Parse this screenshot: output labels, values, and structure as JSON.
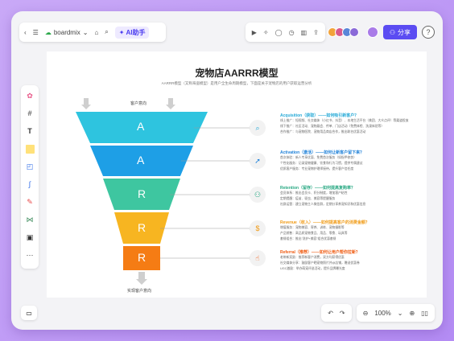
{
  "app": {
    "brand": "boardmix",
    "ai_label": "AI助手",
    "share_label": "分享",
    "help_label": "?",
    "zoom": "100%"
  },
  "diagram": {
    "title": "宠物店AARRR模型",
    "subtitle": "AARRR模型（又称海盗模型）是用户全生命周期模型，下面是关于宠物店的用户获取运营分析",
    "top_label": "客户意向",
    "bottom_label": "实现客户意向",
    "stages": [
      {
        "letter": "A",
        "color": "#2ec4df",
        "heading": "Acquisition（获取）——如何吸引新客户？",
        "head_color": "#22a8d6",
        "lines": [
          "线上推广：短视频、社交媒体（小红书、抖音）、本地生活平台（美团、大众点评）等渠道投放",
          "线下推广：社区活动、宠物展会、传单、门店活动（免费体检、洗澡体验等）",
          "合作推广：与宠物医院、宠物用品商店合作，推出联名优惠活动"
        ]
      },
      {
        "letter": "A",
        "color": "#1e9fe6",
        "heading": "Activation（激活）——如何让新客户留下来？",
        "head_color": "#1b7fd8",
        "lines": [
          "首次体验：新人专享优惠、免费首次服务（如指甲修剪）",
          "个性化服务：记录宠物健康、饮食和行为习惯，提供专属建议",
          "优质客户服务：专业宠物护理师接待，提升客户信任度"
        ]
      },
      {
        "letter": "R",
        "color": "#3ec6a0",
        "heading": "Retention（留存）——如何提高复购率？",
        "head_color": "#27a882",
        "lines": [
          "会员体系：推出会员卡、积分制度，增加客户粘性",
          "定期提醒：疫苗、驱虫、美容等提醒服务",
          "社群运营：建立宠物主人微信群，定期分享养宠知识和优惠信息"
        ]
      },
      {
        "letter": "R",
        "color": "#f7b521",
        "heading": "Revenue（收入）——如何提高客户的消费金额？",
        "head_color": "#f09a14",
        "lines": [
          "增值服务：宠物美容、寄养、训练、宠物摄影等",
          "产品销售：高品质宠物食品、用品、零食、玩具等",
          "套餐组合：推出\"洗护+美容\"组合优惠套餐"
        ]
      },
      {
        "letter": "R",
        "color": "#f57c14",
        "heading": "Referral（推荐）——如何让用户帮你拉新？",
        "head_color": "#ef5a10",
        "lines": [
          "老带新奖励：推荐新客户消费，双方均获得优惠",
          "社交媒体分享：鼓励客户晒宠物照片并@店铺，赠送优惠券",
          "UGC激励：举办萌宠评选活动，提升品牌曝光度"
        ]
      }
    ]
  }
}
